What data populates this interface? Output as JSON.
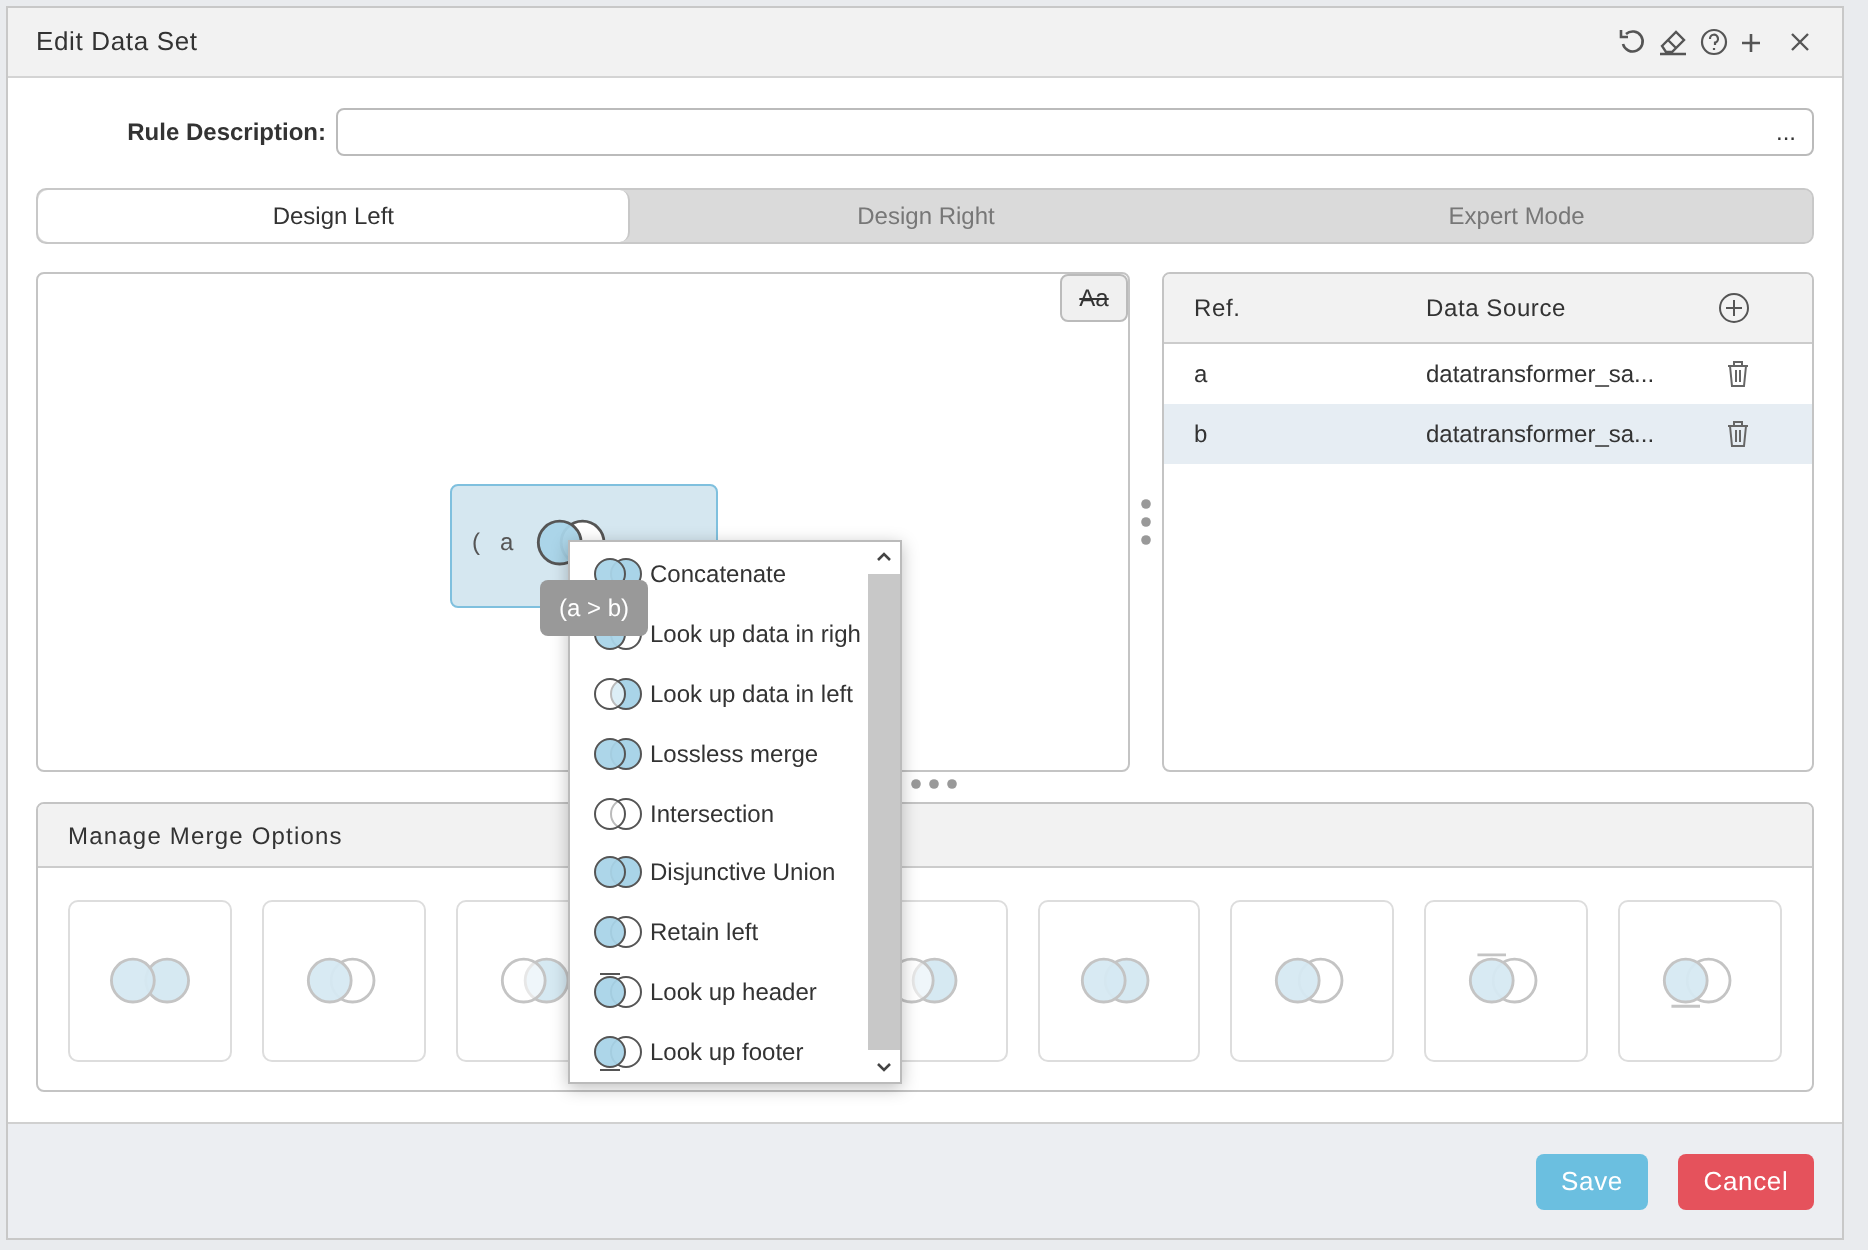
{
  "window": {
    "title": "Edit Data Set"
  },
  "rule_description": {
    "label": "Rule Description:",
    "more": "..."
  },
  "tabs": [
    {
      "label": "Design Left",
      "selected": true
    },
    {
      "label": "Design Right",
      "selected": false
    },
    {
      "label": "Expert Mode",
      "selected": false
    }
  ],
  "canvas": {
    "font_toggle": "Aa",
    "node": {
      "open_paren": "(",
      "ref": "a",
      "kind": "right"
    },
    "tooltip": "(a > b)"
  },
  "references": {
    "columns": [
      "Ref.",
      "Data Source"
    ],
    "rows": [
      {
        "ref": "a",
        "source": "datatransformer_sa...",
        "selected": false
      },
      {
        "ref": "b",
        "source": "datatransformer_sa...",
        "selected": true
      }
    ]
  },
  "merge_menu": [
    {
      "label": "Concatenate",
      "kind": "both"
    },
    {
      "label": "Look up data in righ",
      "kind": "right"
    },
    {
      "label": "Look up data in left",
      "kind": "left"
    },
    {
      "label": "Lossless merge",
      "kind": "both"
    },
    {
      "label": "Intersection",
      "kind": "none"
    },
    {
      "label": "Disjunctive Union",
      "kind": "both"
    },
    {
      "label": "Retain left",
      "kind": "right"
    },
    {
      "label": "Look up header",
      "kind": "header"
    },
    {
      "label": "Look up footer",
      "kind": "footer"
    }
  ],
  "merge_options": {
    "title": "Manage Merge Options",
    "tiles": [
      {
        "kind": "apart"
      },
      {
        "kind": "right"
      },
      {
        "kind": "left"
      },
      {
        "kind": "left"
      },
      {
        "kind": "both"
      },
      {
        "kind": "right"
      },
      {
        "kind": "header"
      },
      {
        "kind": "footer"
      }
    ]
  },
  "buttons": [
    {
      "label": "Save",
      "kind": "primary"
    },
    {
      "label": "Cancel",
      "kind": "danger"
    }
  ]
}
